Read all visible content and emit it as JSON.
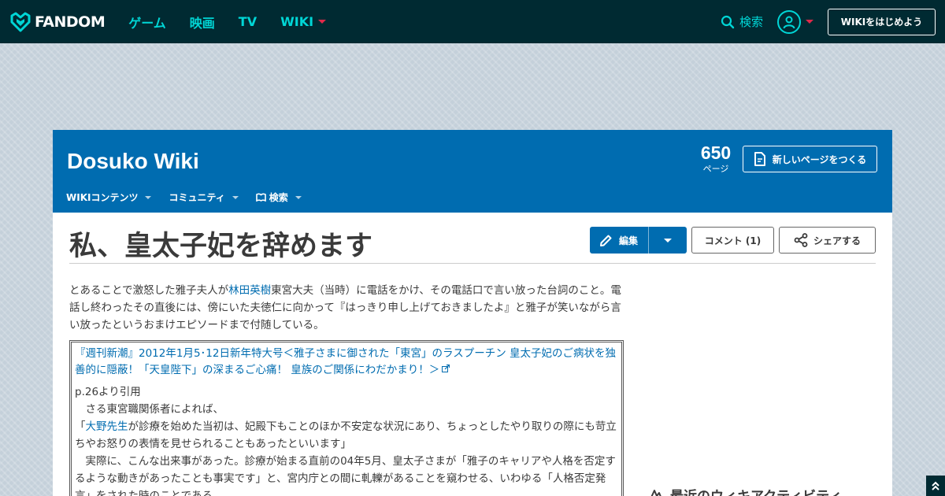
{
  "global_nav": {
    "brand": "FANDOM",
    "links": [
      "ゲーム",
      "映画",
      "TV",
      "WIKI"
    ],
    "search_label": "検索",
    "start_wiki_label": "WIKIをはじめよう"
  },
  "wiki_header": {
    "name": "Dosuko Wiki",
    "page_count": "650",
    "page_count_label": "ページ",
    "new_page_label": "新しいページをつくる",
    "nav": [
      "WIKIコンテンツ",
      "コミュニティ",
      "検索"
    ]
  },
  "page": {
    "title": "私、皇太子妃を辞めます",
    "edit_label": "編集",
    "comment_label": "コメント (1)",
    "share_label": "シェアする",
    "intro_before_link": "とあることで激怒した雅子夫人が",
    "intro_link": "林田英樹",
    "intro_after_link": "東宮大夫（当時）に電話をかけ、その電話口で言い放った台詞のこと。電話し終わったその直後には、傍にいた夫徳仁に向かって『はっきり申し上げておきましたよ』と雅子が笑いながら言い放ったというおまけエピソードまで付随している。",
    "quote": {
      "source_link": "『週刊新潮』2012年1月5･12日新年特大号＜雅子さまに御された「東宮」のラスプーチン 皇太子妃のご病状を独善的に隠蔽！「天皇陛下」の深まるご心痛！ 皇族のご関係にわだかまり！＞",
      "citation": "p.26より引用",
      "line1": "　さる東宮職関係者によれば、",
      "line2_open": "「",
      "line2_link": "大野先生",
      "line2_rest": "が診療を始めた当初は、妃殿下もことのほか不安定な状況にあり、ちょっとしたやり取りの際にも苛立ちやお怒りの表情を見せられることもあったといいます」",
      "line3": "　実際に、こんな出来事があった。診療が始まる直前の04年5月、皇太子さまが「雅子のキャリアや人格を否定するような動きがあったことも事実です」と、宮内庁との間に軋轢があることを窺わせる、いわゆる「人格否定発言」をされた時のことである。"
    },
    "recent_activity_heading": "最近のウィキアクティビティ"
  },
  "colors": {
    "global_nav_bg": "#002a32",
    "accent_teal": "#00d6d6",
    "wiki_blue": "#006cb0"
  }
}
